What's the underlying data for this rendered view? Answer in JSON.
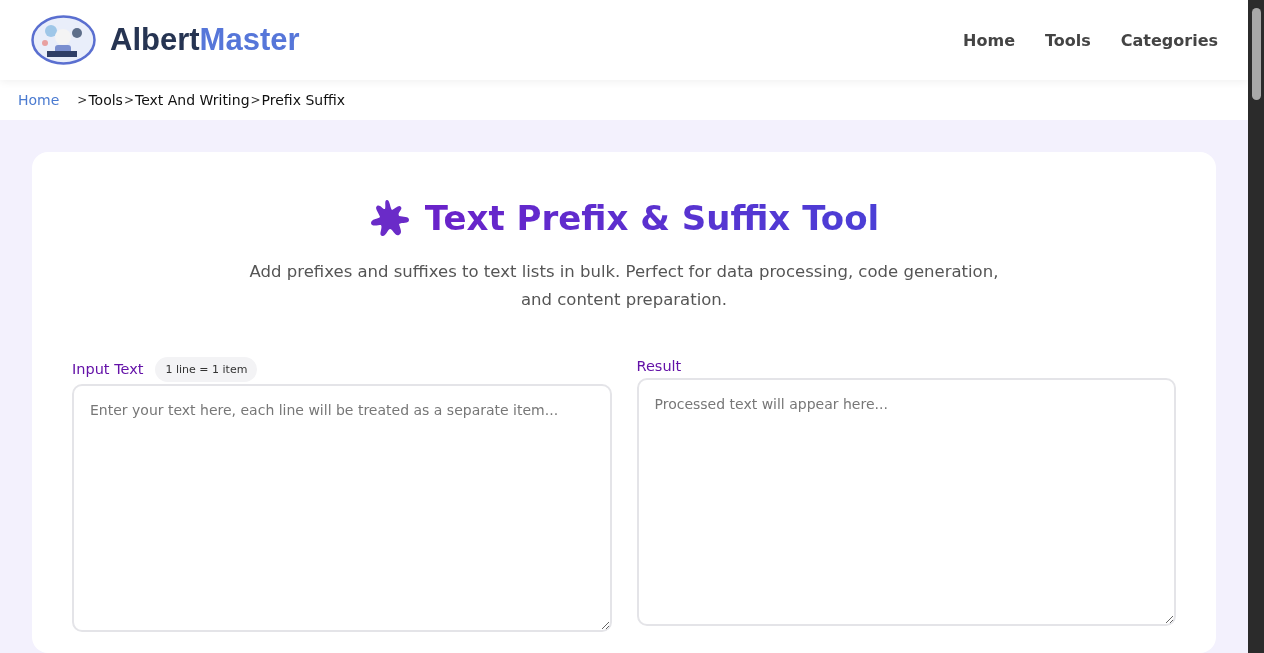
{
  "header": {
    "brand_first": "Albert",
    "brand_second": "Master",
    "nav": [
      "Home",
      "Tools",
      "Categories"
    ]
  },
  "breadcrumb": [
    {
      "label": "Home",
      "kind": "link"
    },
    {
      "sep": ">",
      "label": "Tools",
      "kind": "crumb"
    },
    {
      "sep": ">",
      "label": "Text And Writing",
      "kind": "crumb"
    },
    {
      "sep": ">",
      "label": "Prefix Suffix",
      "kind": "crumb"
    }
  ],
  "tool": {
    "title": "Text Prefix & Suffix Tool",
    "description_lines": [
      "Add prefixes and suffixes to text lists in bulk. Perfect for data processing, code generation,",
      "and content preparation."
    ],
    "input": {
      "label": "Input Text",
      "badge": "1 line = 1 item",
      "placeholder": "Enter your text here, each line will be treated as a separate item..."
    },
    "result": {
      "label": "Result",
      "placeholder": "Processed text will appear here..."
    }
  }
}
